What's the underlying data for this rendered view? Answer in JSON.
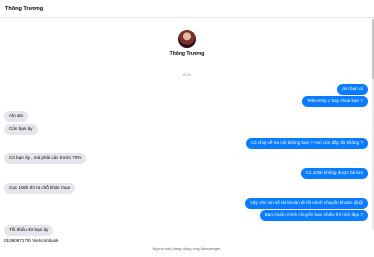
{
  "header": {
    "contact_name": "Thông Trương"
  },
  "profile": {
    "name": "Thông Trương"
  },
  "timestamp": "8:09",
  "messages": {
    "m1": "Alo bạn ơi",
    "m2": "Telecomp c bay chua bạn ?",
    "m3": "Alo alo",
    "m4": "Còn bạn ảy",
    "m5": "Có chip về tra nội không bạn ? Hơi còn đầy đủ không ?",
    "m6": "Có bạn ảy , mà phải các trước 70%",
    "m7": "Có 100k không được bà bro",
    "m8": "Cọc 100k thì ra chỗ khác mua",
    "m9": "Vậy cho xin số tài khoản đi rồi mình chuyển khoản @@",
    "m10": "Bạn muốn mình chuyển bao nhiêu thì mới đẹp ?",
    "m11": "Tối thiểu 4tr bạn ảy",
    "m12": "0109097178\\ Vietcombank"
  },
  "footer": {
    "note": "Người này đang dùng ứng Messenger."
  }
}
